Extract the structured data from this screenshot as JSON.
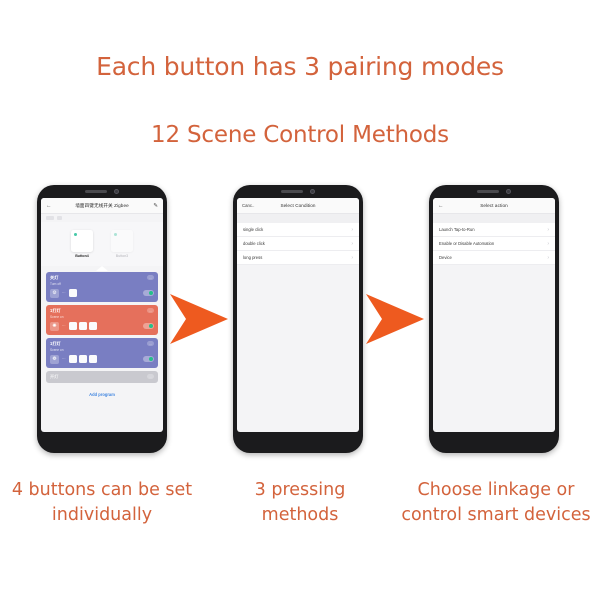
{
  "headings": {
    "line1": "Each button has 3 pairing modes",
    "line2": "12 Scene Control Methods"
  },
  "colors": {
    "accent_orange": "#ee5a1f",
    "heading_text": "#d3633c",
    "card_purple": "#797ec2",
    "card_red": "#e5705c",
    "card_gray": "#c9c9cf",
    "link_blue": "#3f85e0",
    "toggle_green": "#24c08a"
  },
  "phones": [
    {
      "name": "device-program-screen",
      "appbar": {
        "back_icon": "←",
        "title": "墙面四键无线开关 Zigbee",
        "edit_icon": "✎"
      },
      "tiles": [
        {
          "label": "Button4",
          "active": true
        },
        {
          "label": "Button3",
          "active": false
        }
      ],
      "programs": [
        {
          "title": "关灯",
          "subtitle": "Turn off",
          "badge": "···",
          "icon": "⚙",
          "dots": "···",
          "buttons": 1,
          "toggle_on": true,
          "style": "purple"
        },
        {
          "title": "1打灯",
          "subtitle": "Scene on",
          "badge": "···",
          "icon": "✺",
          "dots": "···",
          "buttons": 3,
          "toggle_on": true,
          "style": "red"
        },
        {
          "title": "1打灯",
          "subtitle": "Scene on",
          "badge": "···",
          "icon": "❁",
          "dots": "···",
          "buttons": 3,
          "toggle_on": true,
          "style": "purple"
        },
        {
          "title": "开灯",
          "subtitle": "",
          "badge": "···",
          "icon": "",
          "dots": "",
          "buttons": 0,
          "toggle_on": false,
          "style": "gray"
        }
      ],
      "add_program": "Add program"
    },
    {
      "name": "select-condition-screen",
      "appbar": {
        "cancel_label": "Canc..",
        "title": "Select Condition"
      },
      "rows": [
        {
          "label": "single click",
          "chevron": "›"
        },
        {
          "label": "double click",
          "chevron": "›"
        },
        {
          "label": "long press",
          "chevron": "›"
        }
      ]
    },
    {
      "name": "select-action-screen",
      "appbar": {
        "back_icon": "←",
        "title": "Select action"
      },
      "rows": [
        {
          "label": "Launch Tap-to-Run",
          "chevron": "›"
        },
        {
          "label": "Enable or Disable Automation",
          "chevron": "›"
        },
        {
          "label": "Device",
          "chevron": "›"
        }
      ]
    }
  ],
  "arrows": [
    {
      "name": "arrow-step-1-to-2"
    },
    {
      "name": "arrow-step-2-to-3"
    }
  ],
  "captions": [
    "4 buttons can be set individually",
    "3 pressing methods",
    "Choose linkage or control smart devices"
  ]
}
